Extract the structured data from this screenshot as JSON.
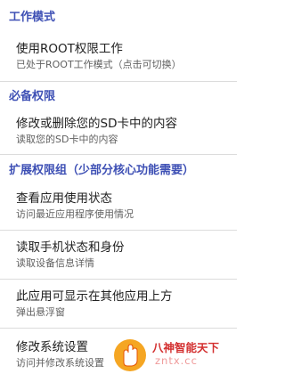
{
  "sections": [
    {
      "header": "工作模式",
      "items": [
        {
          "title": "使用ROOT权限工作",
          "summary": "已处于ROOT工作模式（点击可切换）"
        }
      ]
    },
    {
      "header": "必备权限",
      "items": [
        {
          "title": "修改或删除您的SD卡中的内容",
          "summary": "读取您的SD卡中的内容"
        }
      ]
    },
    {
      "header": "扩展权限组（少部分核心功能需要）",
      "items": [
        {
          "title": "查看应用使用状态",
          "summary": "访问最近应用程序使用情况"
        },
        {
          "title": "读取手机状态和身份",
          "summary": "读取设备信息详情"
        },
        {
          "title": "此应用可显示在其他应用上方",
          "summary": "弹出悬浮窗"
        },
        {
          "title": "修改系统设置",
          "summary": "访问并修改系统设置"
        }
      ]
    }
  ],
  "watermark": {
    "text": "八神智能天下",
    "domain": "zntx.cc",
    "logo": "hand-logo-icon"
  },
  "colors": {
    "section_header": "#3f51b5",
    "title": "#212121",
    "summary": "#616161",
    "divider": "#dcdcdc",
    "watermark": "#d32f2f"
  }
}
